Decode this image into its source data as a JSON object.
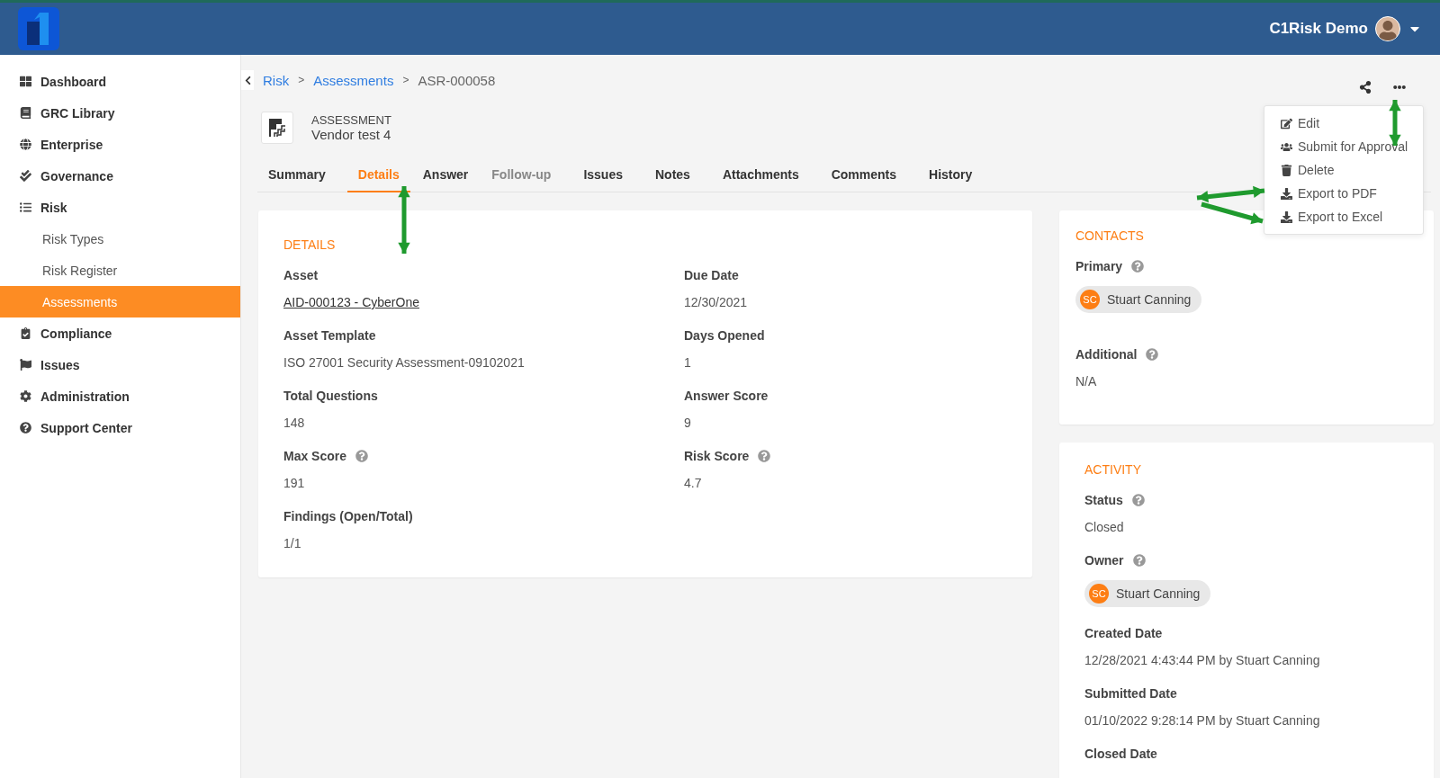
{
  "header": {
    "user_name": "C1Risk Demo"
  },
  "sidebar": {
    "items": [
      {
        "label": "Dashboard",
        "selected": false
      },
      {
        "label": "GRC Library",
        "selected": false
      },
      {
        "label": "Enterprise",
        "selected": false
      },
      {
        "label": "Governance",
        "selected": false
      },
      {
        "label": "Risk",
        "selected": false,
        "children": [
          {
            "label": "Risk Types",
            "selected": false
          },
          {
            "label": "Risk Register",
            "selected": false
          },
          {
            "label": "Assessments",
            "selected": true
          }
        ]
      },
      {
        "label": "Compliance",
        "selected": false
      },
      {
        "label": "Issues",
        "selected": false
      },
      {
        "label": "Administration",
        "selected": false
      },
      {
        "label": "Support Center",
        "selected": false
      }
    ]
  },
  "breadcrumb": [
    {
      "label": "Risk",
      "kind": "link"
    },
    {
      "label": ">",
      "kind": "separator"
    },
    {
      "label": "Assessments",
      "kind": "link"
    },
    {
      "label": ">",
      "kind": "separator"
    },
    {
      "label": "ASR-000058",
      "kind": "current"
    }
  ],
  "record": {
    "type_label": "ASSESSMENT",
    "name": "Vendor test 4"
  },
  "tabs": [
    {
      "label": "Summary",
      "selected": false,
      "disabled": false
    },
    {
      "label": "Details",
      "selected": true,
      "disabled": false
    },
    {
      "label": "Answer",
      "selected": false,
      "disabled": false
    },
    {
      "label": "Follow-up",
      "selected": false,
      "disabled": true
    },
    {
      "label": "Issues",
      "selected": false,
      "disabled": false
    },
    {
      "label": "Notes",
      "selected": false,
      "disabled": false
    },
    {
      "label": "Attachments",
      "selected": false,
      "disabled": false
    },
    {
      "label": "Comments",
      "selected": false,
      "disabled": false
    },
    {
      "label": "History",
      "selected": false,
      "disabled": false
    }
  ],
  "details": {
    "title": "DETAILS",
    "fields": [
      {
        "label": "Asset",
        "help": false,
        "kind": "link",
        "value": "AID-000123 - CyberOne"
      },
      {
        "label": "Due Date",
        "help": false,
        "kind": "text",
        "value": "12/30/2021"
      },
      {
        "label": "Asset Template",
        "help": false,
        "kind": "text",
        "value": "ISO 27001 Security Assessment-09102021"
      },
      {
        "label": "Days Opened",
        "help": false,
        "kind": "text",
        "value": "1"
      },
      {
        "label": "Total Questions",
        "help": false,
        "kind": "text",
        "value": "148"
      },
      {
        "label": "Answer Score",
        "help": false,
        "kind": "text",
        "value": "9"
      },
      {
        "label": "Max Score",
        "help": true,
        "kind": "text",
        "value": "191"
      },
      {
        "label": "Risk Score",
        "help": true,
        "kind": "text",
        "value": "4.7"
      },
      {
        "label": "Findings (Open/Total)",
        "help": false,
        "kind": "text",
        "value": "1/1"
      }
    ]
  },
  "contacts": {
    "title": "CONTACTS",
    "fields": [
      {
        "label": "Primary",
        "help": true,
        "kind": "person",
        "initials": "SC",
        "value": "Stuart Canning"
      },
      {
        "label": "Additional",
        "help": true,
        "kind": "text",
        "value": "N/A"
      }
    ]
  },
  "activity": {
    "title": "ACTIVITY",
    "fields": [
      {
        "label": "Status",
        "help": true,
        "kind": "text",
        "value": "Closed"
      },
      {
        "label": "Owner",
        "help": true,
        "kind": "person",
        "initials": "SC",
        "value": "Stuart Canning"
      },
      {
        "label": "Created Date",
        "help": false,
        "kind": "text",
        "value": "12/28/2021 4:43:44 PM by Stuart Canning"
      },
      {
        "label": "Submitted Date",
        "help": false,
        "kind": "text",
        "value": "01/10/2022 9:28:14 PM by Stuart Canning"
      },
      {
        "label": "Closed Date",
        "help": false,
        "kind": "label-only"
      }
    ]
  },
  "menu": {
    "items": [
      {
        "label": "Edit"
      },
      {
        "label": "Submit for Approval"
      },
      {
        "label": "Delete"
      },
      {
        "label": "Export to PDF"
      },
      {
        "label": "Export to Excel"
      }
    ]
  }
}
